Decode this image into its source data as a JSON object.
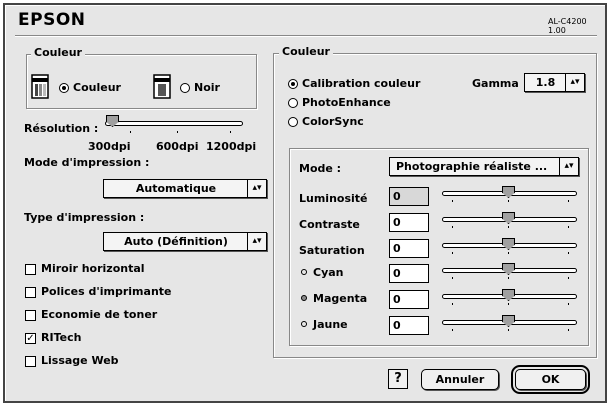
{
  "header": {
    "logo": "EPSON",
    "model": "AL-C4200 1.00"
  },
  "left": {
    "color_group_title": "Couleur",
    "color_option": "Couleur",
    "black_option": "Noir",
    "resolution_label": "Résolution :",
    "resolution_ticks": [
      "300dpi",
      "600dpi",
      "1200dpi"
    ],
    "print_mode_label": "Mode d'impression :",
    "print_mode_value": "Automatique",
    "print_type_label": "Type d'impression :",
    "print_type_value": "Auto (Définition)",
    "checkboxes": [
      {
        "label": "Miroir horizontal",
        "checked": false
      },
      {
        "label": "Polices d'imprimante",
        "checked": false
      },
      {
        "label": "Economie de toner",
        "checked": false
      },
      {
        "label": "RITech",
        "checked": true
      },
      {
        "label": "Lissage Web",
        "checked": false
      }
    ]
  },
  "right": {
    "group_title": "Couleur",
    "radio_calibration": "Calibration couleur",
    "radio_photoenhance": "PhotoEnhance",
    "radio_colorsync": "ColorSync",
    "gamma_label": "Gamma",
    "gamma_value": "1.8",
    "mode_label": "Mode :",
    "mode_value": "Photographie réaliste ...",
    "rows": [
      {
        "label": "Luminosité",
        "value": "0"
      },
      {
        "label": "Contraste",
        "value": "0"
      },
      {
        "label": "Saturation",
        "value": "0"
      },
      {
        "label": "Cyan",
        "value": "0"
      },
      {
        "label": "Magenta",
        "value": "0"
      },
      {
        "label": "Jaune",
        "value": "0"
      }
    ]
  },
  "footer": {
    "help": "?",
    "cancel": "Annuler",
    "ok": "OK"
  }
}
